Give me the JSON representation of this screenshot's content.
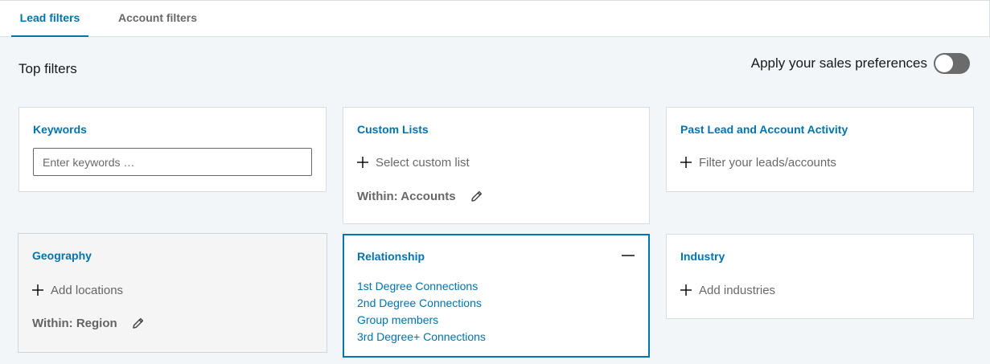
{
  "tabs": [
    {
      "label": "Lead filters",
      "active": true
    },
    {
      "label": "Account filters",
      "active": false
    }
  ],
  "section_title": "Top filters",
  "preferences": {
    "label": "Apply your sales preferences",
    "enabled": false
  },
  "cards": {
    "keywords": {
      "title": "Keywords",
      "input_placeholder": "Enter keywords …",
      "input_value": ""
    },
    "custom_lists": {
      "title": "Custom Lists",
      "add_label": "Select custom list",
      "within_label": "Within: Accounts"
    },
    "past_activity": {
      "title": "Past Lead and Account Activity",
      "add_label": "Filter your leads/accounts"
    },
    "geography": {
      "title": "Geography",
      "add_label": "Add locations",
      "within_label": "Within: Region"
    },
    "relationship": {
      "title": "Relationship",
      "options": [
        "1st Degree Connections",
        "2nd Degree Connections",
        "Group members",
        "3rd Degree+ Connections"
      ]
    },
    "industry": {
      "title": "Industry",
      "add_label": "Add industries"
    }
  },
  "colors": {
    "accent": "#0073b1",
    "background": "#f3f6f8",
    "toggle_off": "#6b6b6b"
  }
}
